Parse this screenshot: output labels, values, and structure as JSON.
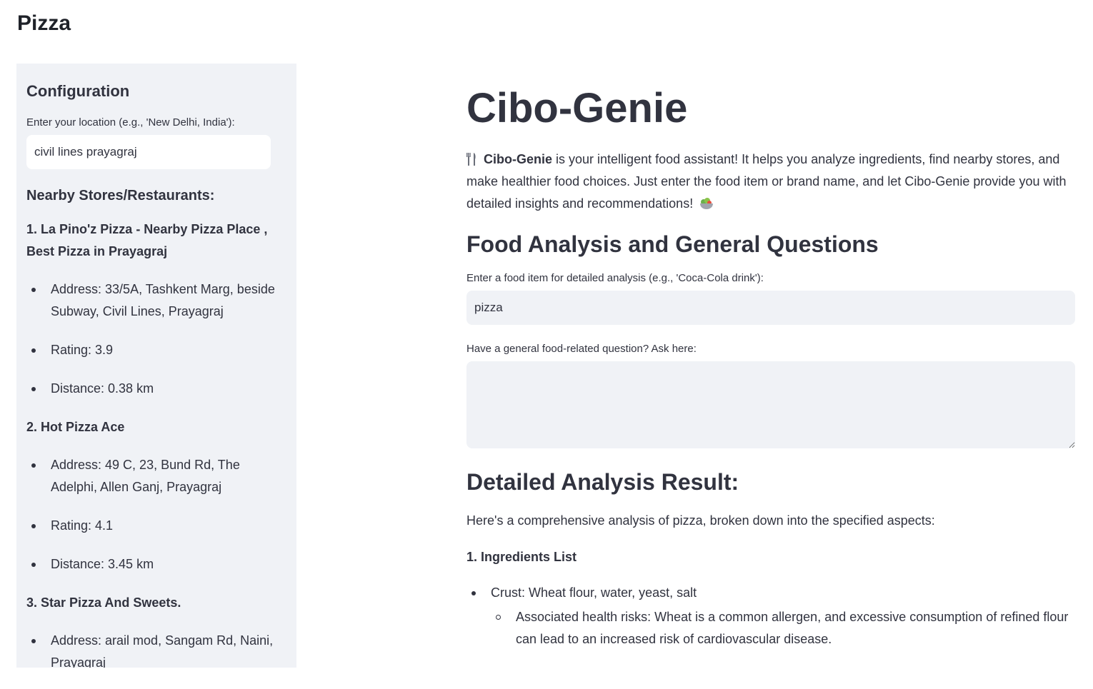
{
  "page_title": "Pizza",
  "sidebar": {
    "heading": "Configuration",
    "location_label": "Enter your location (e.g., 'New Delhi, India'):",
    "location_value": "civil lines prayagraj",
    "stores_title": "Nearby Stores/Restaurants:",
    "stores": [
      {
        "name": "1. La Pino'z Pizza - Nearby Pizza Place , Best Pizza in Prayagraj",
        "address": "Address: 33/5A, Tashkent Marg, beside Subway, Civil Lines, Prayagraj",
        "rating": "Rating: 3.9",
        "distance": "Distance: 0.38 km"
      },
      {
        "name": "2. Hot Pizza Ace",
        "address": "Address: 49 C, 23, Bund Rd, The Adelphi, Allen Ganj, Prayagraj",
        "rating": "Rating: 4.1",
        "distance": "Distance: 3.45 km"
      },
      {
        "name": "3. Star Pizza And Sweets.",
        "address": "Address: arail mod, Sangam Rd, Naini, Prayagraj"
      }
    ]
  },
  "main": {
    "app_title": "Cibo-Genie",
    "intro_bold": "Cibo-Genie",
    "intro_text": " is your intelligent food assistant! It helps you analyze ingredients, find nearby stores, and make healthier food choices. Just enter the food item or brand name, and let Cibo-Genie provide you with detailed insights and recommendations!",
    "section_heading": "Food Analysis and General Questions",
    "food_label": "Enter a food item for detailed analysis (e.g., 'Coca-Cola drink'):",
    "food_value": "pizza",
    "question_label": "Have a general food-related question? Ask here:",
    "question_value": "",
    "result_heading": "Detailed Analysis Result:",
    "result_intro": "Here's a comprehensive analysis of pizza, broken down into the specified aspects:",
    "ingredients_heading": "1. Ingredients List",
    "ingredients": [
      {
        "item": "Crust: Wheat flour, water, yeast, salt",
        "detail": "Associated health risks: Wheat is a common allergen, and excessive consumption of refined flour can lead to an increased risk of cardiovascular disease."
      }
    ]
  }
}
